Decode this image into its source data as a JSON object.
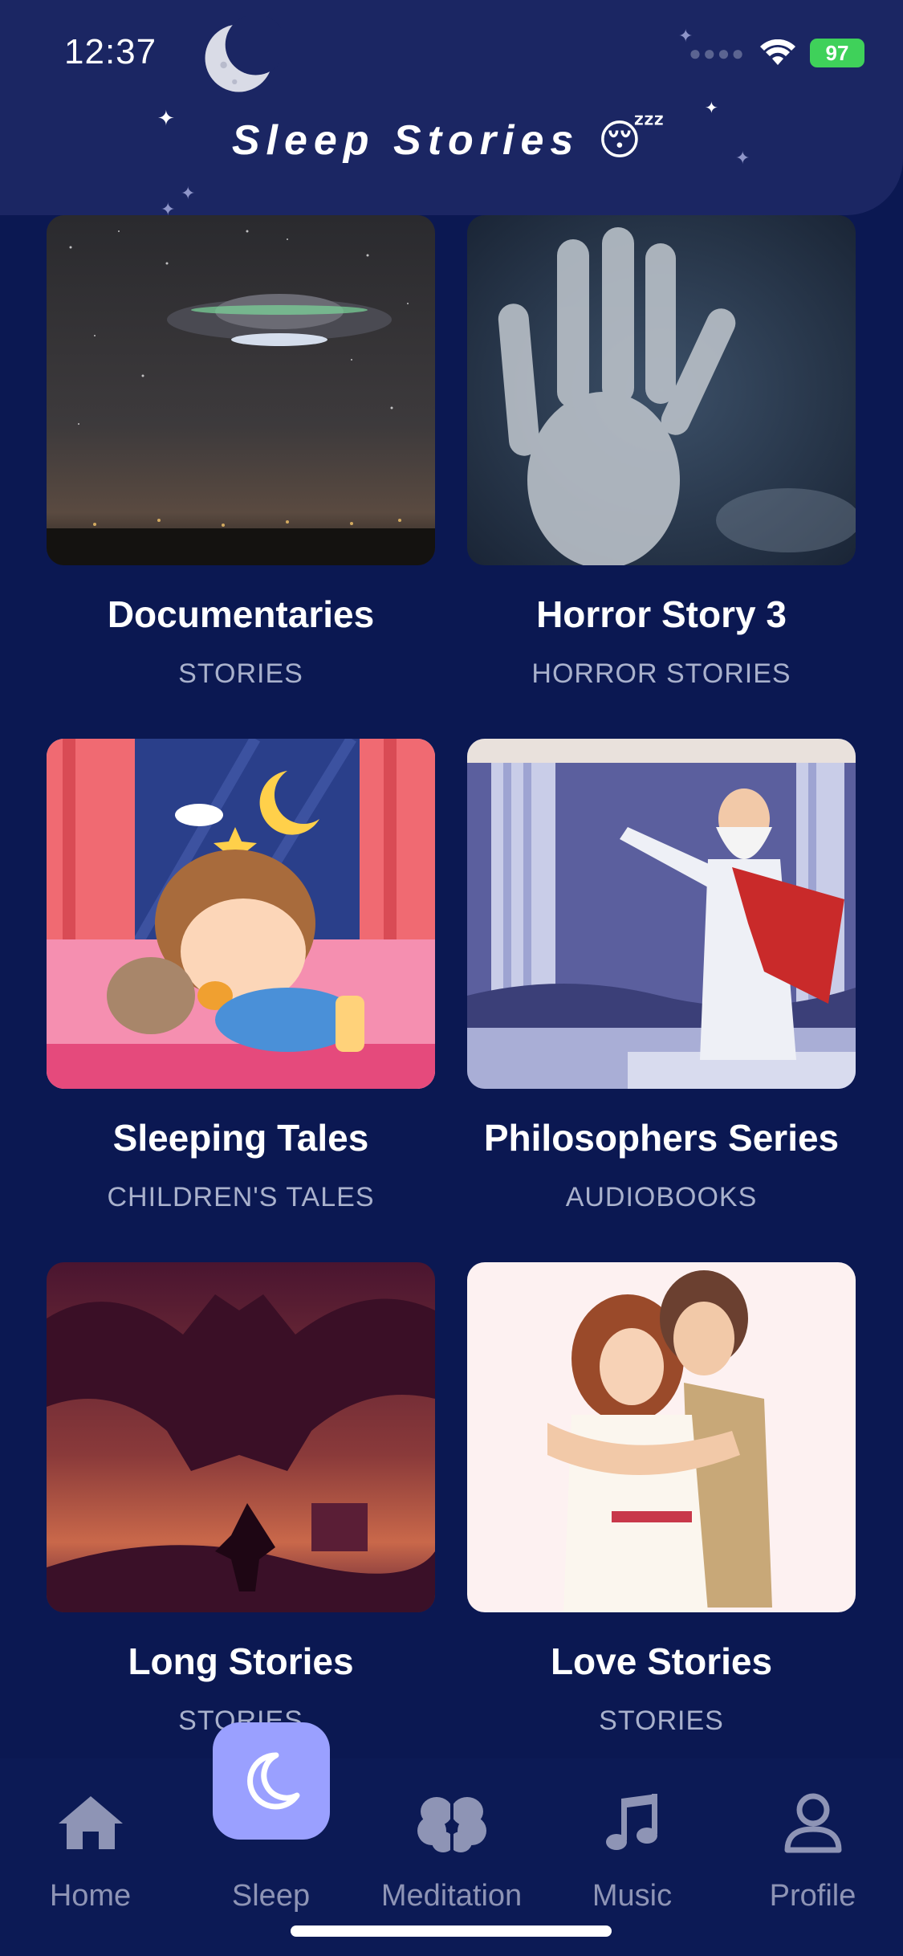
{
  "status_bar": {
    "time": "12:37",
    "battery": "97",
    "signal_icon": "cellular-signal-icon",
    "wifi_icon": "wifi-icon"
  },
  "header": {
    "title": "Sleep Stories 😴",
    "background_color": "#1b2663"
  },
  "cards": [
    {
      "title": "Documentaries",
      "subtitle": "STORIES",
      "image": "ufo-night-sky-illustration"
    },
    {
      "title": "Horror Story 3",
      "subtitle": "HORROR STORIES",
      "image": "hand-on-glass-illustration"
    },
    {
      "title": "Sleeping Tales",
      "subtitle": "CHILDREN'S TALES",
      "image": "sleeping-child-illustration"
    },
    {
      "title": "Philosophers Series",
      "subtitle": "AUDIOBOOKS",
      "image": "philosopher-illustration"
    },
    {
      "title": "Long Stories",
      "subtitle": "STORIES",
      "image": "dragon-knight-illustration"
    },
    {
      "title": "Love Stories",
      "subtitle": "STORIES",
      "image": "couple-embrace-illustration"
    }
  ],
  "tabbar": {
    "active": "Sleep",
    "active_color": "#9aa0ff",
    "items": [
      {
        "label": "Home",
        "icon": "home-icon"
      },
      {
        "label": "Sleep",
        "icon": "moon-icon"
      },
      {
        "label": "Meditation",
        "icon": "brain-icon"
      },
      {
        "label": "Music",
        "icon": "music-note-icon"
      },
      {
        "label": "Profile",
        "icon": "profile-icon"
      }
    ]
  },
  "colors": {
    "background": "#0b1852",
    "subtitle": "#a9b1cc",
    "tab_inactive": "#8e94b5"
  }
}
